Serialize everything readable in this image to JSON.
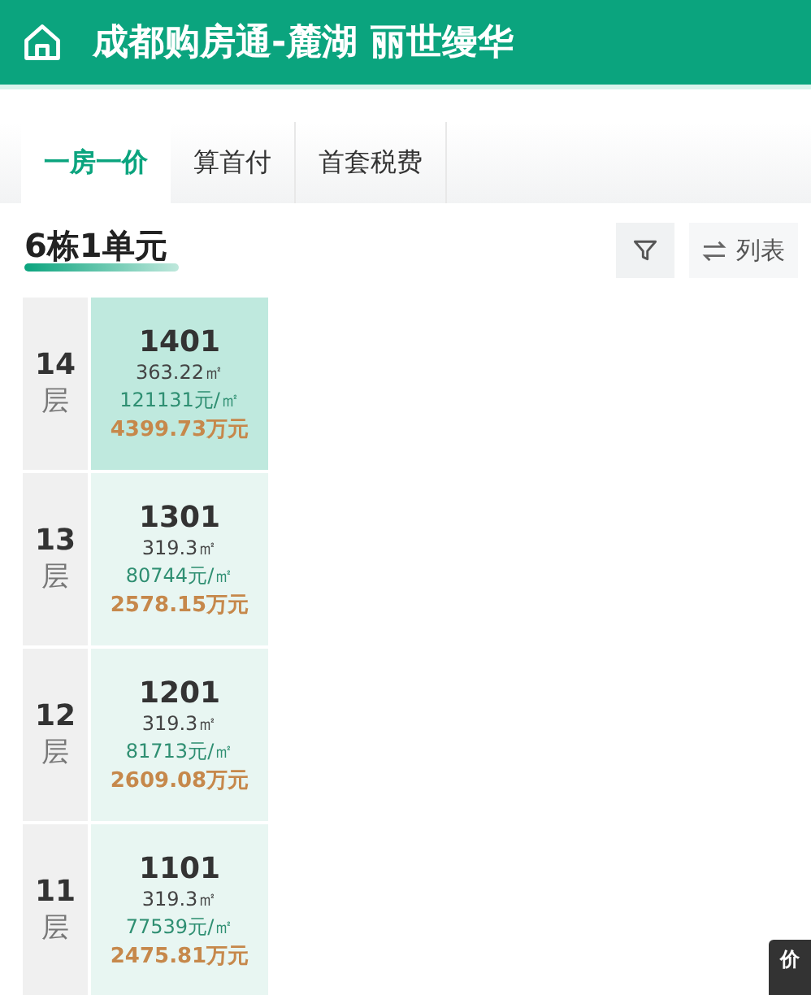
{
  "header": {
    "title": "成都购房通-麓湖 丽世缦华"
  },
  "tabs": [
    {
      "label": "一房一价",
      "selected": true
    },
    {
      "label": "算首付",
      "selected": false
    },
    {
      "label": "首套税费",
      "selected": false
    }
  ],
  "section": {
    "title": "6栋1单元",
    "list_button": "列表"
  },
  "floors": [
    {
      "floor": "14",
      "floor_unit": "层",
      "unit": "1401",
      "area": "363.22㎡",
      "unit_price": "121131元/㎡",
      "total": "4399.73万元",
      "selected": true
    },
    {
      "floor": "13",
      "floor_unit": "层",
      "unit": "1301",
      "area": "319.3㎡",
      "unit_price": "80744元/㎡",
      "total": "2578.15万元",
      "selected": false
    },
    {
      "floor": "12",
      "floor_unit": "层",
      "unit": "1201",
      "area": "319.3㎡",
      "unit_price": "81713元/㎡",
      "total": "2609.08万元",
      "selected": false
    },
    {
      "floor": "11",
      "floor_unit": "层",
      "unit": "1101",
      "area": "319.3㎡",
      "unit_price": "77539元/㎡",
      "total": "2475.81万元",
      "selected": false
    }
  ],
  "side_tab": "价"
}
